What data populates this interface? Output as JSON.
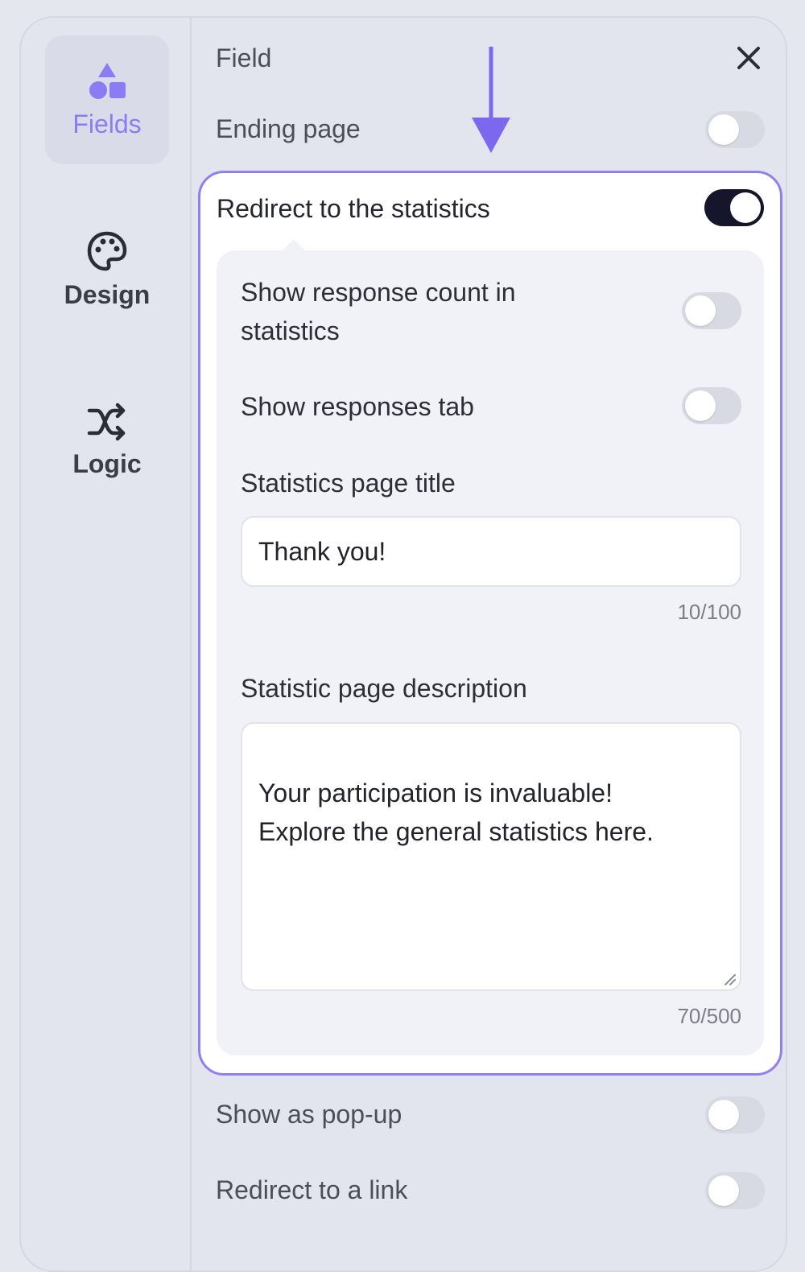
{
  "rail": {
    "items": [
      {
        "label": "Fields",
        "icon": "shapes-icon",
        "active": true
      },
      {
        "label": "Design",
        "icon": "palette-icon",
        "active": false
      },
      {
        "label": "Logic",
        "icon": "shuffle-icon",
        "active": false
      }
    ]
  },
  "header": {
    "title": "Field",
    "close_icon": "close-icon"
  },
  "ending_page": {
    "label": "Ending page",
    "enabled": false
  },
  "statistics": {
    "label": "Redirect to the statistics",
    "enabled": true,
    "show_response_count": {
      "label": "Show response count in statistics",
      "enabled": false
    },
    "show_responses_tab": {
      "label": "Show responses tab",
      "enabled": false
    },
    "title_field": {
      "label": "Statistics page title",
      "value": "Thank you!",
      "counter": "10/100"
    },
    "description_field": {
      "label": "Statistic page description",
      "value": "Your participation is invaluable!\nExplore the general statistics here.",
      "counter": "70/500"
    }
  },
  "show_popup": {
    "label": "Show as pop-up",
    "enabled": false
  },
  "redirect_link": {
    "label": "Redirect to a link",
    "enabled": false
  },
  "colors": {
    "accent": "#8a7cf2",
    "arrow": "#7b68ee",
    "toggle_on": "#15162b",
    "toggle_off": "#c9ccd6"
  }
}
